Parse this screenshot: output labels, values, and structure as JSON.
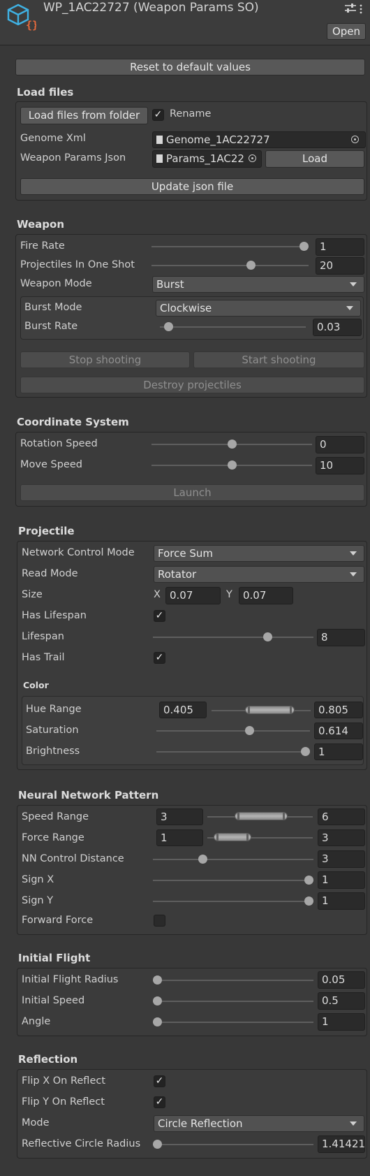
{
  "header": {
    "title": "WP_1AC22727 (Weapon Params SO)",
    "open_label": "Open",
    "icon": "cube-script-icon",
    "settings_icon": "sliders-icon"
  },
  "reset_label": "Reset to default values",
  "load_files": {
    "title": "Load files",
    "load_folder_label": "Load files from folder",
    "rename_label": "Rename",
    "rename_checked": true,
    "genome_label": "Genome Xml",
    "genome_value": "Genome_1AC22727",
    "params_label": "Weapon Params Json",
    "params_value": "Params_1AC22",
    "load_label": "Load",
    "update_label": "Update json file"
  },
  "weapon": {
    "title": "Weapon",
    "fire_rate_label": "Fire Rate",
    "fire_rate_value": "1",
    "fire_rate_slider": 1.0,
    "projectiles_label": "Projectiles In One Shot",
    "projectiles_value": "20",
    "projectiles_slider": 0.64,
    "mode_label": "Weapon Mode",
    "mode_value": "Burst",
    "burst_mode_label": "Burst Mode",
    "burst_mode_value": "Clockwise",
    "burst_rate_label": "Burst Rate",
    "burst_rate_value": "0.03",
    "burst_rate_slider": 0.03,
    "stop_label": "Stop shooting",
    "start_label": "Start shooting",
    "destroy_label": "Destroy projectiles"
  },
  "coord": {
    "title": "Coordinate System",
    "rotation_label": "Rotation Speed",
    "rotation_value": "0",
    "rotation_slider": 0.5,
    "move_label": "Move Speed",
    "move_value": "10",
    "move_slider": 0.5,
    "launch_label": "Launch"
  },
  "projectile": {
    "title": "Projectile",
    "ncm_label": "Network Control Mode",
    "ncm_value": "Force Sum",
    "read_label": "Read Mode",
    "read_value": "Rotator",
    "size_label": "Size",
    "size_x_label": "X",
    "size_x": "0.07",
    "size_y_label": "Y",
    "size_y": "0.07",
    "has_lifespan_label": "Has Lifespan",
    "has_lifespan": true,
    "lifespan_label": "Lifespan",
    "lifespan_value": "8",
    "lifespan_slider": 0.73,
    "has_trail_label": "Has Trail",
    "has_trail": true,
    "color_title": "Color",
    "hue_label": "Hue Range",
    "hue_min": "0.405",
    "hue_max": "0.805",
    "saturation_label": "Saturation",
    "saturation_value": "0.614",
    "saturation_slider": 0.614,
    "brightness_label": "Brightness",
    "brightness_value": "1",
    "brightness_slider": 1.0
  },
  "nn": {
    "title": "Neural Network Pattern",
    "speed_label": "Speed Range",
    "speed_min": "3",
    "speed_max": "6",
    "force_label": "Force Range",
    "force_min": "1",
    "force_max": "3",
    "nn_dist_label": "NN Control Distance",
    "nn_dist_value": "3",
    "nn_dist_slider": 0.3,
    "sign_x_label": "Sign X",
    "sign_x_value": "1",
    "sign_x_slider": 1.0,
    "sign_y_label": "Sign Y",
    "sign_y_value": "1",
    "sign_y_slider": 1.0,
    "forward_label": "Forward Force",
    "forward_checked": false
  },
  "initial": {
    "title": "Initial Flight",
    "radius_label": "Initial Flight Radius",
    "radius_value": "0.05",
    "radius_slider": 0.0,
    "speed_label": "Initial Speed",
    "speed_value": "0.5",
    "speed_slider": 0.0,
    "angle_label": "Angle",
    "angle_value": "1",
    "angle_slider": 0.0
  },
  "reflection": {
    "title": "Reflection",
    "flip_x_label": "Flip X On Reflect",
    "flip_x": true,
    "flip_y_label": "Flip Y On Reflect",
    "flip_y": true,
    "mode_label": "Mode",
    "mode_value": "Circle Reflection",
    "radius_label": "Reflective Circle Radius",
    "radius_value": "1.41421",
    "radius_slider": 0.0
  }
}
